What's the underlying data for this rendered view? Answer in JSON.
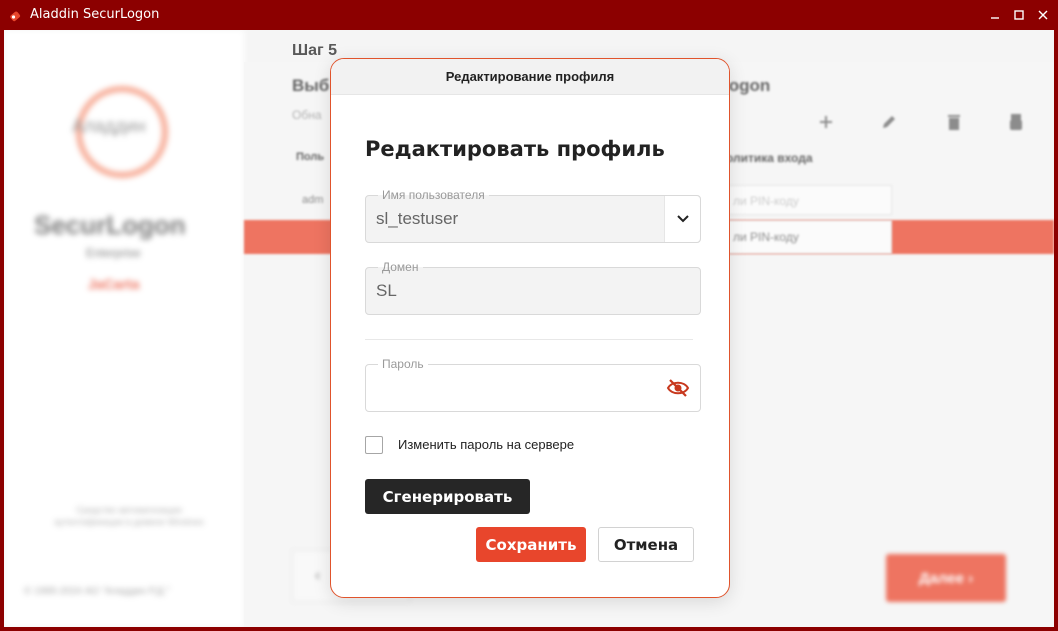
{
  "window": {
    "title": "Aladdin SecurLogon",
    "icon": "key-icon",
    "controls": {
      "minimize": "minimize-icon",
      "maximize": "maximize-icon",
      "close": "close-icon"
    }
  },
  "background": {
    "sidebar": {
      "logo_text": "Аладдин",
      "product": "SecurLogon",
      "edition": "Enterprise",
      "brand": "JaCarta",
      "note": "Средство автоматизации аутентификации в домене Windows",
      "copyright": "© 1995-2024 АО \"Аладдин Р.Д.\""
    },
    "step": "Шаг 5",
    "heading": "Выб",
    "heading_right": "logon",
    "subtitle": "Обна",
    "toolbar_icons": [
      "plus-icon",
      "pencil-icon",
      "trash-icon",
      "usb-token-icon"
    ],
    "table": {
      "col_user": "Поль",
      "col_policy": "олитика входа",
      "row1_user": "adm",
      "row1_policy": "ли PIN-коду",
      "row2_policy": "ли PIN-коду"
    },
    "back_label": "‹",
    "next_label": "Далее ›"
  },
  "dialog": {
    "header": "Редактирование профиля",
    "title": "Редактировать профиль",
    "username": {
      "label": "Имя пользователя",
      "value": "sl_testuser"
    },
    "domain": {
      "label": "Домен",
      "value": "SL"
    },
    "password": {
      "label": "Пароль",
      "value": ""
    },
    "change_password_label": "Изменить пароль на сервере",
    "change_password_checked": false,
    "generate_label": "Сгенерировать",
    "save_label": "Сохранить",
    "cancel_label": "Отмена"
  },
  "colors": {
    "titlebar": "#8c0000",
    "accent": "#e8462c",
    "dark_button": "#262626"
  }
}
